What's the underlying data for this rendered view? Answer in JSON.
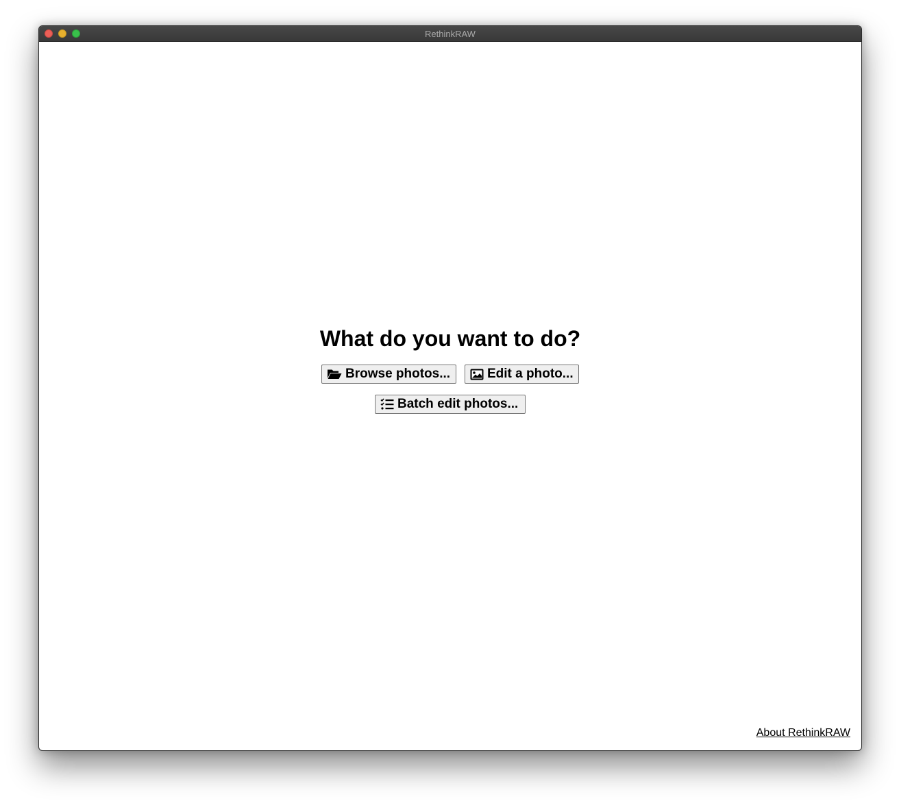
{
  "window": {
    "title": "RethinkRAW"
  },
  "main": {
    "heading": "What do you want to do?",
    "buttons": {
      "browse": {
        "label": "Browse photos...",
        "icon": "folder-open-icon"
      },
      "edit": {
        "label": "Edit a photo...",
        "icon": "image-icon"
      },
      "batch": {
        "label": "Batch edit photos...",
        "icon": "task-list-icon"
      }
    }
  },
  "footer": {
    "about_link": "About RethinkRAW"
  },
  "colors": {
    "titlebar": "#3f3f3f",
    "close": "#ec5f57",
    "minimize": "#e8b12e",
    "zoom": "#39c04b",
    "button_background": "#efefef"
  }
}
